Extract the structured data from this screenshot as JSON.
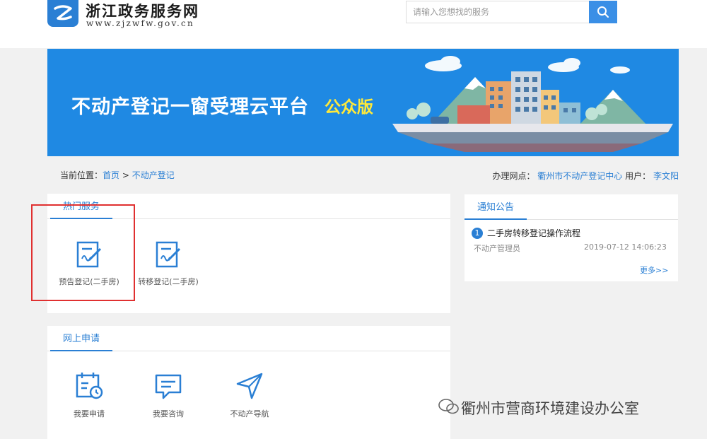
{
  "header": {
    "site_title": "浙江政务服务网",
    "site_url": "www.zjzwfw.gov.cn",
    "search_placeholder": "请输入您想找的服务"
  },
  "banner": {
    "title": "不动产登记一窗受理云平台",
    "subtitle": "公众版"
  },
  "breadcrumb": {
    "label": "当前位置：",
    "home": "首页",
    "separator": ">",
    "current": "不动产登记"
  },
  "office": {
    "label": "办理网点：",
    "value": "衢州市不动产登记中心",
    "user_label": "用户：",
    "user": "李文阳"
  },
  "hot_services": {
    "tab": "热门服务",
    "items": [
      {
        "label": "预告登记(二手房)",
        "icon": "form-edit-icon"
      },
      {
        "label": "转移登记(二手房)",
        "icon": "form-edit-icon"
      }
    ]
  },
  "online_apply": {
    "tab": "网上申请",
    "items": [
      {
        "label": "我要申请",
        "icon": "calendar-clock-icon"
      },
      {
        "label": "我要咨询",
        "icon": "chat-icon"
      },
      {
        "label": "不动产导航",
        "icon": "navigation-icon"
      }
    ]
  },
  "notice": {
    "tab": "通知公告",
    "items": [
      {
        "num": "1",
        "title": "二手房转移登记操作流程",
        "author": "不动产管理员",
        "time": "2019-07-12 14:06:23"
      }
    ],
    "more": "更多>>"
  },
  "watermark": "衢州市营商环境建设办公室",
  "colors": {
    "accent": "#2a7fd4",
    "banner": "#1f89e3",
    "highlight": "#e03030",
    "subtitle": "#ffe93a"
  }
}
